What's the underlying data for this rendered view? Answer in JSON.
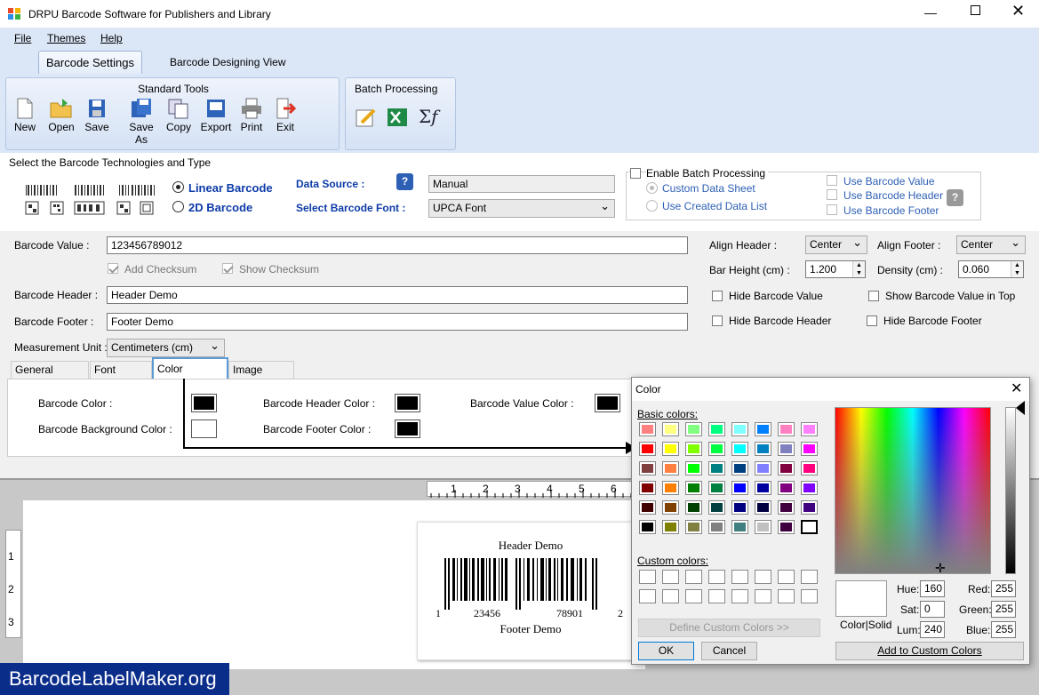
{
  "window": {
    "title": "DRPU Barcode Software for Publishers and Library"
  },
  "menu": {
    "items": [
      "File",
      "Themes",
      "Help"
    ]
  },
  "tabs": {
    "main": [
      "Barcode Settings",
      "Barcode Designing View"
    ]
  },
  "ribbon": {
    "standard_title": "Standard Tools",
    "tools": [
      "New",
      "Open",
      "Save",
      "Save As",
      "Copy",
      "Export",
      "Print",
      "Exit"
    ],
    "batch_title": "Batch Processing"
  },
  "tech": {
    "title": "Select the Barcode Technologies and Type",
    "linear": "Linear Barcode",
    "twod": "2D Barcode",
    "data_source_label": "Data Source :",
    "data_source_value": "Manual",
    "font_label": "Select Barcode Font :",
    "font_value": "UPCA Font"
  },
  "batch": {
    "enable": "Enable Batch Processing",
    "custom_sheet": "Custom Data Sheet",
    "created_list": "Use Created Data List",
    "use_value": "Use Barcode Value",
    "use_header": "Use Barcode Header",
    "use_footer": "Use Barcode Footer"
  },
  "form": {
    "value_label": "Barcode Value :",
    "value": "123456789012",
    "add_checksum": "Add Checksum",
    "show_checksum": "Show Checksum",
    "header_label": "Barcode Header :",
    "header": "Header Demo",
    "footer_label": "Barcode Footer :",
    "footer": "Footer Demo",
    "unit_label": "Measurement Unit :",
    "unit": "Centimeters (cm)"
  },
  "align": {
    "header_label": "Align Header :",
    "header": "Center",
    "footer_label": "Align Footer :",
    "footer": "Center",
    "bar_height_label": "Bar Height (cm) :",
    "bar_height": "1.200",
    "density_label": "Density (cm) :",
    "density": "0.060",
    "hide_value": "Hide Barcode Value",
    "show_top": "Show Barcode Value in Top",
    "hide_header": "Hide Barcode Header",
    "hide_footer": "Hide Barcode Footer"
  },
  "subtabs": [
    "General Settings",
    "Font Settings",
    "Color Settings",
    "Image Settings"
  ],
  "colors": {
    "barcode": "Barcode Color :",
    "background": "Barcode Background Color :",
    "header": "Barcode Header Color :",
    "footer": "Barcode Footer Color :",
    "value": "Barcode Value Color :"
  },
  "ruler": {
    "h": [
      "1",
      "2",
      "3",
      "4",
      "5",
      "6"
    ],
    "v": [
      "1",
      "2",
      "3"
    ]
  },
  "preview": {
    "header": "Header Demo",
    "footer": "Footer Demo",
    "digits": [
      "1",
      "23456",
      "78901",
      "2"
    ]
  },
  "dialog": {
    "title": "Color",
    "basic": "Basic colors:",
    "custom": "Custom colors:",
    "define": "Define Custom Colors >>",
    "ok": "OK",
    "cancel": "Cancel",
    "colorsolid": "Color|Solid",
    "hue_label": "Hue:",
    "hue": "160",
    "sat_label": "Sat:",
    "sat": "0",
    "lum_label": "Lum:",
    "lum": "240",
    "red_label": "Red:",
    "red": "255",
    "green_label": "Green:",
    "green": "255",
    "blue_label": "Blue:",
    "blue": "255",
    "add": "Add to Custom Colors",
    "basic_colors": [
      "#ff8080",
      "#ffff80",
      "#80ff80",
      "#00ff80",
      "#80ffff",
      "#0080ff",
      "#ff80c0",
      "#ff80ff",
      "#ff0000",
      "#ffff00",
      "#80ff00",
      "#00ff40",
      "#00ffff",
      "#0080c0",
      "#8080c0",
      "#ff00ff",
      "#804040",
      "#ff8040",
      "#00ff00",
      "#008080",
      "#004080",
      "#8080ff",
      "#800040",
      "#ff0080",
      "#800000",
      "#ff8000",
      "#008000",
      "#008040",
      "#0000ff",
      "#0000a0",
      "#800080",
      "#8000ff",
      "#400000",
      "#804000",
      "#004000",
      "#004040",
      "#000080",
      "#000040",
      "#400040",
      "#400080",
      "#000000",
      "#808000",
      "#808040",
      "#808080",
      "#408080",
      "#c0c0c0",
      "#400040",
      "#ffffff"
    ]
  },
  "watermark": "BarcodeLabelMaker.org"
}
